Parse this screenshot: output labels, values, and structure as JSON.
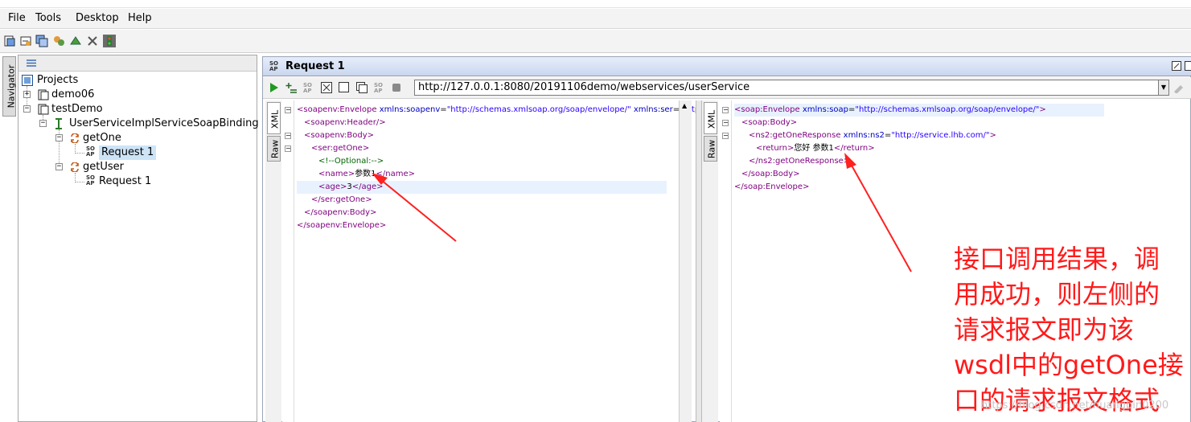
{
  "menu": {
    "file": "File",
    "tools": "Tools",
    "desktop": "Desktop",
    "help": "Help"
  },
  "navigator": {
    "tab_label": "Navigator",
    "tree": {
      "projects": "Projects",
      "demo06": "demo06",
      "testDemo": "testDemo",
      "binding": "UserServiceImplServiceSoapBinding",
      "getOne": "getOne",
      "getOne_request": "Request 1",
      "getUser": "getUser",
      "getUser_request": "Request 1"
    }
  },
  "request_window": {
    "title": "Request 1",
    "url": "http://127.0.0.1:8080/20191106demo/webservices/userService"
  },
  "tabs": {
    "xml": "XML",
    "raw": "Raw"
  },
  "request_xml": [
    {
      "open": "<soapenv:Envelope",
      "attr1": " xmlns:soapenv",
      "eq1": "=",
      "val1": "\"http://schemas.xmlsoap.org/soap/envelope/\"",
      "attr2": " xmlns:ser",
      "eq2": "=",
      "val2": "\"http",
      "close": ""
    },
    {
      "open": "<soapenv:Header/>"
    },
    {
      "open": "<soapenv:Body>"
    },
    {
      "open": "<ser:getOne>"
    },
    {
      "comment": "<!--Optional:-->"
    },
    {
      "open": "<name>",
      "text": "参数1",
      "close": "</name>"
    },
    {
      "open": "<age>",
      "text": "3",
      "close": "</age>"
    },
    {
      "open": "</ser:getOne>"
    },
    {
      "open": "</soapenv:Body>"
    },
    {
      "open": "</soapenv:Envelope>"
    }
  ],
  "response_xml": [
    {
      "open": "<soap:Envelope",
      "attr1": " xmlns:soap",
      "eq1": "=",
      "val1": "\"http://schemas.xmlsoap.org/soap/envelope/\"",
      "close": ">"
    },
    {
      "open": "<soap:Body>"
    },
    {
      "open": "<ns2:getOneResponse",
      "attr1": " xmlns:ns2",
      "eq1": "=",
      "val1": "\"http://service.lhb.com/\"",
      "close": ">"
    },
    {
      "open": "<return>",
      "text": "您好 参数1",
      "close": "</return>"
    },
    {
      "open": "</ns2:getOneResponse>"
    },
    {
      "open": "</soap:Body>"
    },
    {
      "open": "</soap:Envelope>"
    }
  ],
  "annotation": {
    "lines": [
      "接口调用结果，调",
      "用成功，则左侧的",
      "请求报文即为该",
      "wsdl中的getOne接",
      "口的请求报文格式"
    ]
  },
  "watermark": "https://blog.csdn.net/huangbin0200",
  "colors": {
    "annotation": "#ff1a1a",
    "tag": "#7e007e",
    "attr": "#0000c0",
    "value": "#2a00ff",
    "comment": "#006400"
  }
}
